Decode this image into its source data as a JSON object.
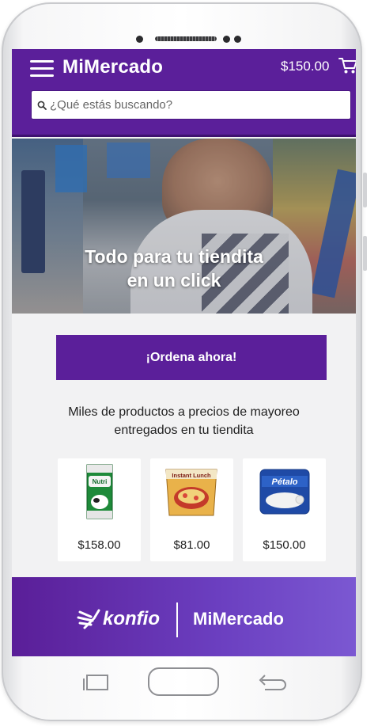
{
  "header": {
    "brand": "MiMercado",
    "cart_total": "$150.00",
    "search_placeholder": "¿Qué estás buscando?"
  },
  "hero": {
    "line1": "Todo para tu tiendita",
    "line2": "en un click"
  },
  "cta": {
    "label": "¡Ordena ahora!"
  },
  "tagline": {
    "line1": "Miles de productos a precios de mayoreo",
    "line2": "entregados en tu tiendita"
  },
  "products": [
    {
      "brand_mark": "Nutri",
      "price": "$158.00",
      "icon": "milk-carton-image"
    },
    {
      "brand_mark": "Instant Lunch",
      "price": "$81.00",
      "icon": "instant-noodles-image"
    },
    {
      "brand_mark": "Pétalo",
      "price": "$150.00",
      "icon": "toilet-paper-image"
    }
  ],
  "footer": {
    "partner": "konfio",
    "brand": "MiMercado"
  },
  "colors": {
    "brand_purple": "#5b1f9a",
    "footer_gradient_end": "#7b58d2",
    "screen_bg": "#f2f2f3"
  },
  "icons": [
    "menu-icon",
    "cart-icon",
    "search-icon",
    "konfio-logo-icon",
    "recent-apps-icon",
    "home-button",
    "back-icon"
  ]
}
